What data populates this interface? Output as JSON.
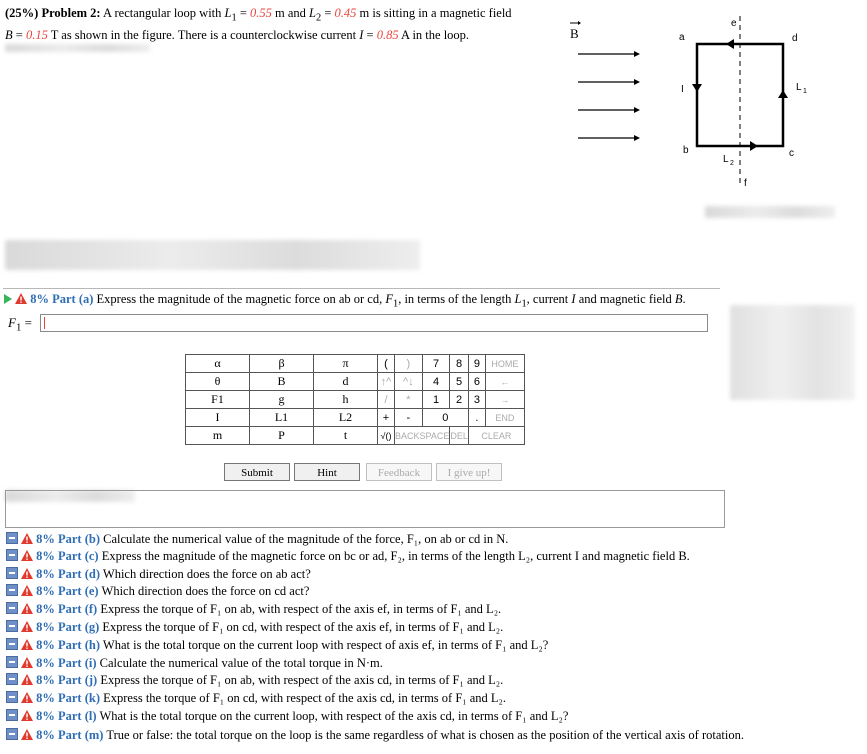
{
  "problem": {
    "prefix": "(25%) Problem 2:",
    "t1": "A rectangular loop with",
    "L1_label": "L",
    "L1_sub": "1",
    "eq": "=",
    "L1_value": "0.55",
    "unit_m1": "m and",
    "L2_label": "L",
    "L2_sub": "2",
    "L2_value": "0.45",
    "t2": "m is sitting in a magnetic field",
    "B_label": "B",
    "B_value": "0.15",
    "t3": "T as shown in the figure. There is a counterclockwise current",
    "I_label": "I",
    "I_value": "0.85",
    "t4": "A in the loop."
  },
  "figure": {
    "B_vec": "B",
    "a": "a",
    "b": "b",
    "c": "c",
    "d": "d",
    "e": "e",
    "f": "f",
    "I": "I",
    "L1": "L",
    "L1_sub": "1",
    "L2": "L",
    "L2_sub": "2"
  },
  "part_a": {
    "label": "8% Part (a)",
    "text_1": "Express the magnitude of the magnetic force on ab or cd,",
    "F1": "F",
    "F1_sub": "1",
    "text_2": ", in terms of the length",
    "L1": "L",
    "L1_sub": "1",
    "text_3": ", current",
    "I": "I",
    "text_4": "and magnetic field",
    "B": "B",
    "text_5": ".",
    "answer_prefix": "F",
    "answer_prefix_sub": "1",
    "answer_eq": "="
  },
  "symbols": [
    [
      "α",
      "β",
      "π"
    ],
    [
      "θ",
      "B",
      "d"
    ],
    [
      "F1",
      "g",
      "h"
    ],
    [
      "I",
      "L1",
      "L2"
    ],
    [
      "m",
      "P",
      "t"
    ]
  ],
  "keypad": {
    "row1": [
      "(",
      ")",
      "7",
      "8",
      "9",
      "HOME"
    ],
    "row2": [
      "↑^",
      "^↓",
      "4",
      "5",
      "6",
      "←"
    ],
    "row3": [
      "/",
      "*",
      "1",
      "2",
      "3",
      "→"
    ],
    "row4": [
      "+",
      "-",
      "0",
      ".",
      "END"
    ],
    "row5": [
      "√()",
      "BACKSPACE",
      "DEL",
      "CLEAR"
    ]
  },
  "buttons": {
    "submit": "Submit",
    "hint": "Hint",
    "feedback": "Feedback",
    "give_up": "I give up!"
  },
  "parts": [
    {
      "label": "8% Part (b)",
      "text": "Calculate the numerical value of the magnitude of the force, F₁, on ab or cd in N."
    },
    {
      "label": "8% Part (c)",
      "text": "Express the magnitude of the magnetic force on bc or ad, F₂, in terms of the length L₂, current I and magnetic field B."
    },
    {
      "label": "8% Part (d)",
      "text": "Which direction does the force on ab act?"
    },
    {
      "label": "8% Part (e)",
      "text": "Which direction does the force on cd act?"
    },
    {
      "label": "8% Part (f)",
      "text": "Express the torque of F₁ on ab, with respect of the axis ef, in terms of F₁ and L₂."
    },
    {
      "label": "8% Part (g)",
      "text": "Express the torque of F₁ on cd, with respect of the axis ef, in terms of F₁ and L₂."
    },
    {
      "label": "8% Part (h)",
      "text": "What is the total torque on the current loop with respect of axis ef, in terms of F₁ and L₂?"
    },
    {
      "label": "8% Part (i)",
      "text": "Calculate the numerical value of the total torque in N·m."
    },
    {
      "label": "8% Part (j)",
      "text": "Express the torque of F₁ on ab, with respect of the axis cd, in terms of F₁ and L₂."
    },
    {
      "label": "8% Part (k)",
      "text": "Express the torque of F₁ on cd, with respect of the axis cd, in terms of F₁ and L₂."
    },
    {
      "label": "8% Part (l)",
      "text": "What is the total torque on the current loop, with respect of the axis cd, in terms of F₁ and L₂?"
    },
    {
      "label": "8% Part (m)",
      "text": "True or false: the total torque on the loop is the same regardless of what is chosen as the position of the vertical axis of rotation."
    }
  ]
}
